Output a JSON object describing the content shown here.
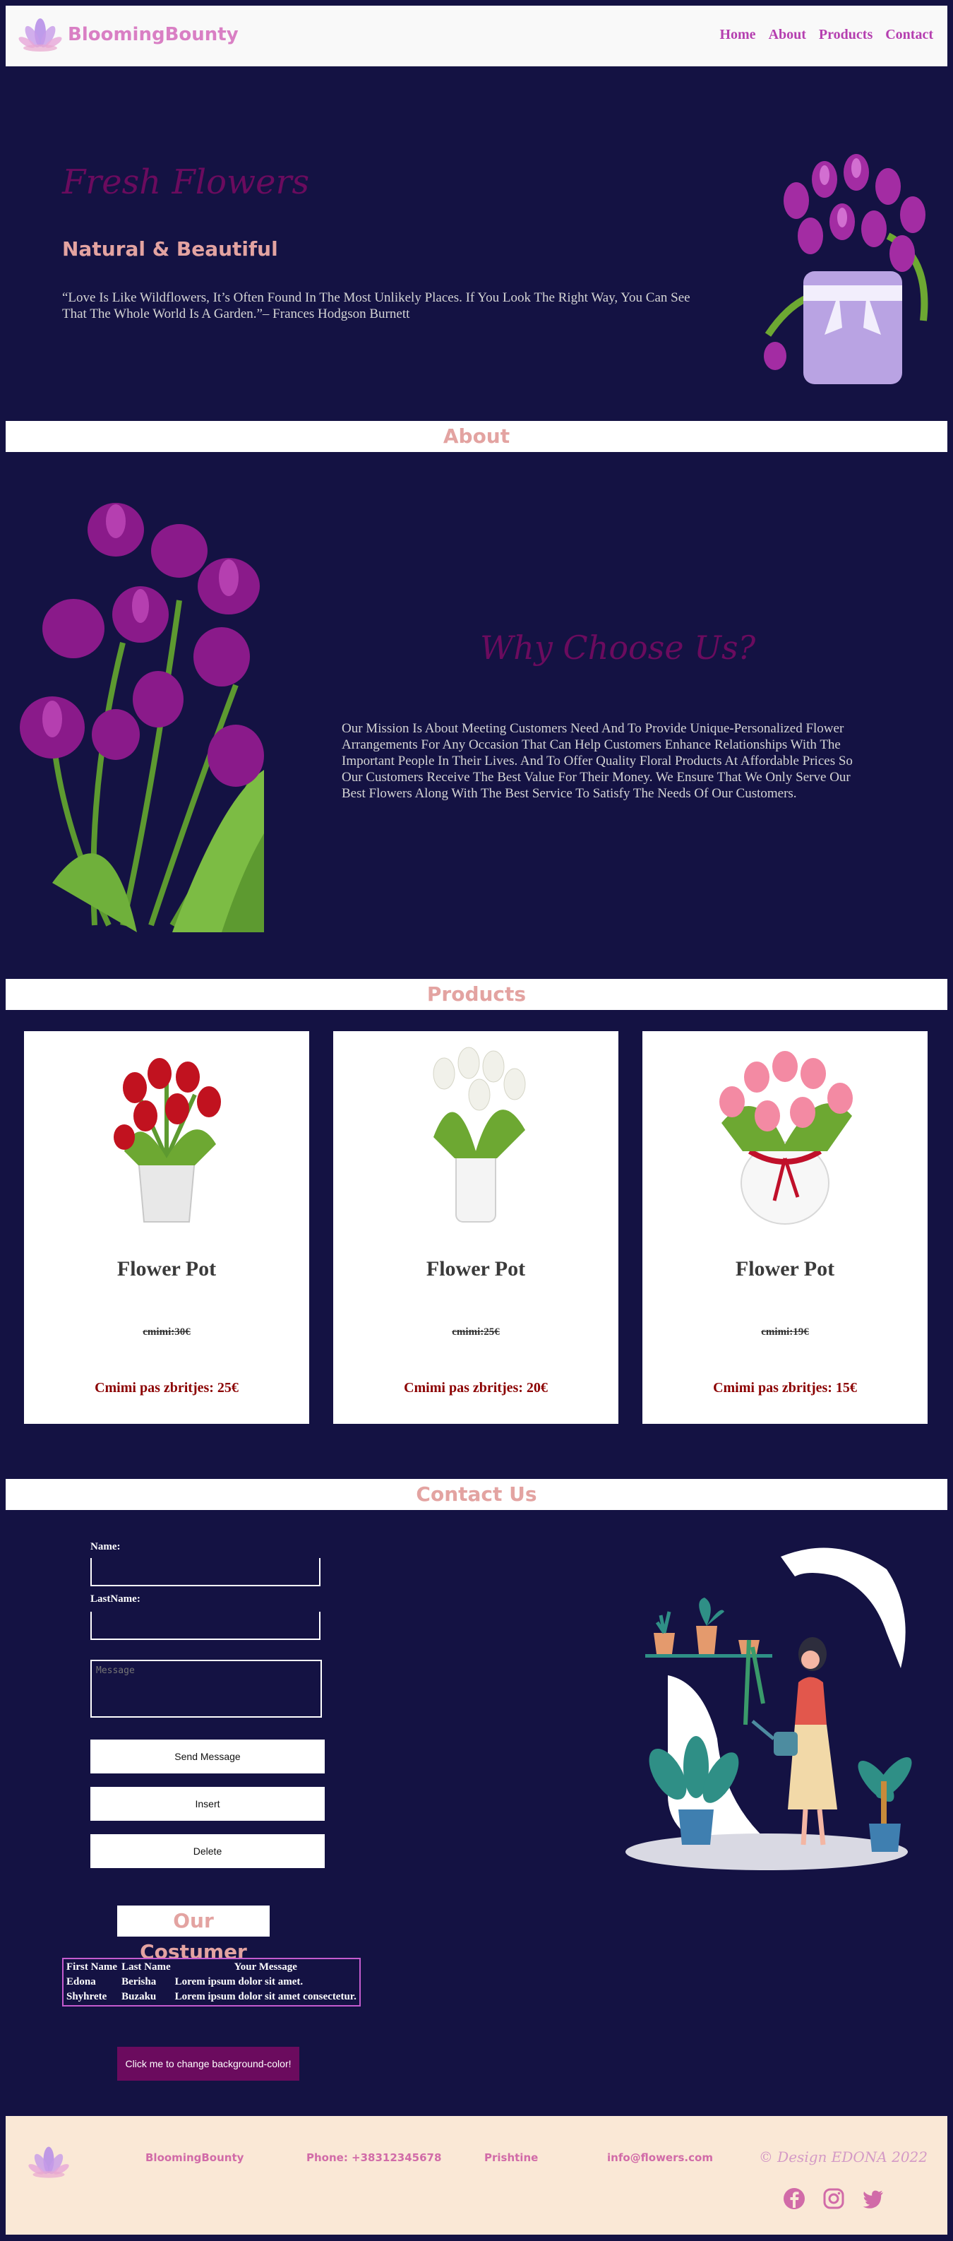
{
  "header": {
    "brand": "BloomingBounty",
    "nav": [
      "Home",
      "About",
      "Products",
      "Contact"
    ]
  },
  "hero": {
    "title": "Fresh Flowers",
    "subtitle": "Natural & Beautiful",
    "quote": "“Love Is Like Wildflowers, It’s Often Found In The Most Unlikely Places. If You Look The Right Way, You Can See That The Whole World Is A Garden.”– Frances Hodgson Burnett"
  },
  "about": {
    "band": "About",
    "title": "Why Choose Us?",
    "text": "Our Mission Is About Meeting Customers Need And To Provide Unique-Personalized Flower Arrangements For Any Occasion That Can Help Customers Enhance Relationships With The Important People In Their Lives. And To Offer Quality Floral Products At Affordable Prices So Our Customers Receive The Best Value For Their Money. We Ensure That We Only Serve Our Best Flowers Along With The Best Service To Satisfy The Needs Of Our Customers."
  },
  "products": {
    "band": "Products",
    "items": [
      {
        "title": "Flower Pot",
        "old_price": "cmimi:30€",
        "new_price": "Cmimi pas zbritjes: 25€",
        "flower_color": "#c1121f"
      },
      {
        "title": "Flower Pot",
        "old_price": "cmimi:25€",
        "new_price": "Cmimi pas zbritjes: 20€",
        "flower_color": "#f1f1ea"
      },
      {
        "title": "Flower Pot",
        "old_price": "cmimi:19€",
        "new_price": "Cmimi pas zbritjes: 15€",
        "flower_color": "#f38aa3"
      }
    ]
  },
  "contact": {
    "band": "Contact Us",
    "name_label": "Name:",
    "lastname_label": "LastName:",
    "message_placeholder": "Message",
    "send_label": "Send Message",
    "insert_label": "Insert",
    "delete_label": "Delete"
  },
  "customers": {
    "title": "Our Costumer",
    "headers": [
      "First Name",
      "Last Name",
      "Your Message"
    ],
    "rows": [
      [
        "Edona",
        "Berisha",
        "Lorem ipsum dolor sit amet."
      ],
      [
        "Shyhrete",
        "Buzaku",
        "Lorem ipsum dolor sit amet consectetur."
      ]
    ],
    "bg_button": "Click me to change background-color!"
  },
  "footer": {
    "brand": "BloomingBounty",
    "phone": "Phone: +38312345678",
    "city": "Prishtine",
    "email": "info@flowers.com",
    "design": "© Design EDONA 2022",
    "socials": [
      "facebook-icon",
      "instagram-icon",
      "twitter-icon"
    ]
  },
  "colors": {
    "background": "#141243",
    "accent_pink": "#e3a3a1",
    "nav_purple": "#b53fb0",
    "heading_plum": "#6b0b5e",
    "footer_bg": "#fae8d6"
  }
}
